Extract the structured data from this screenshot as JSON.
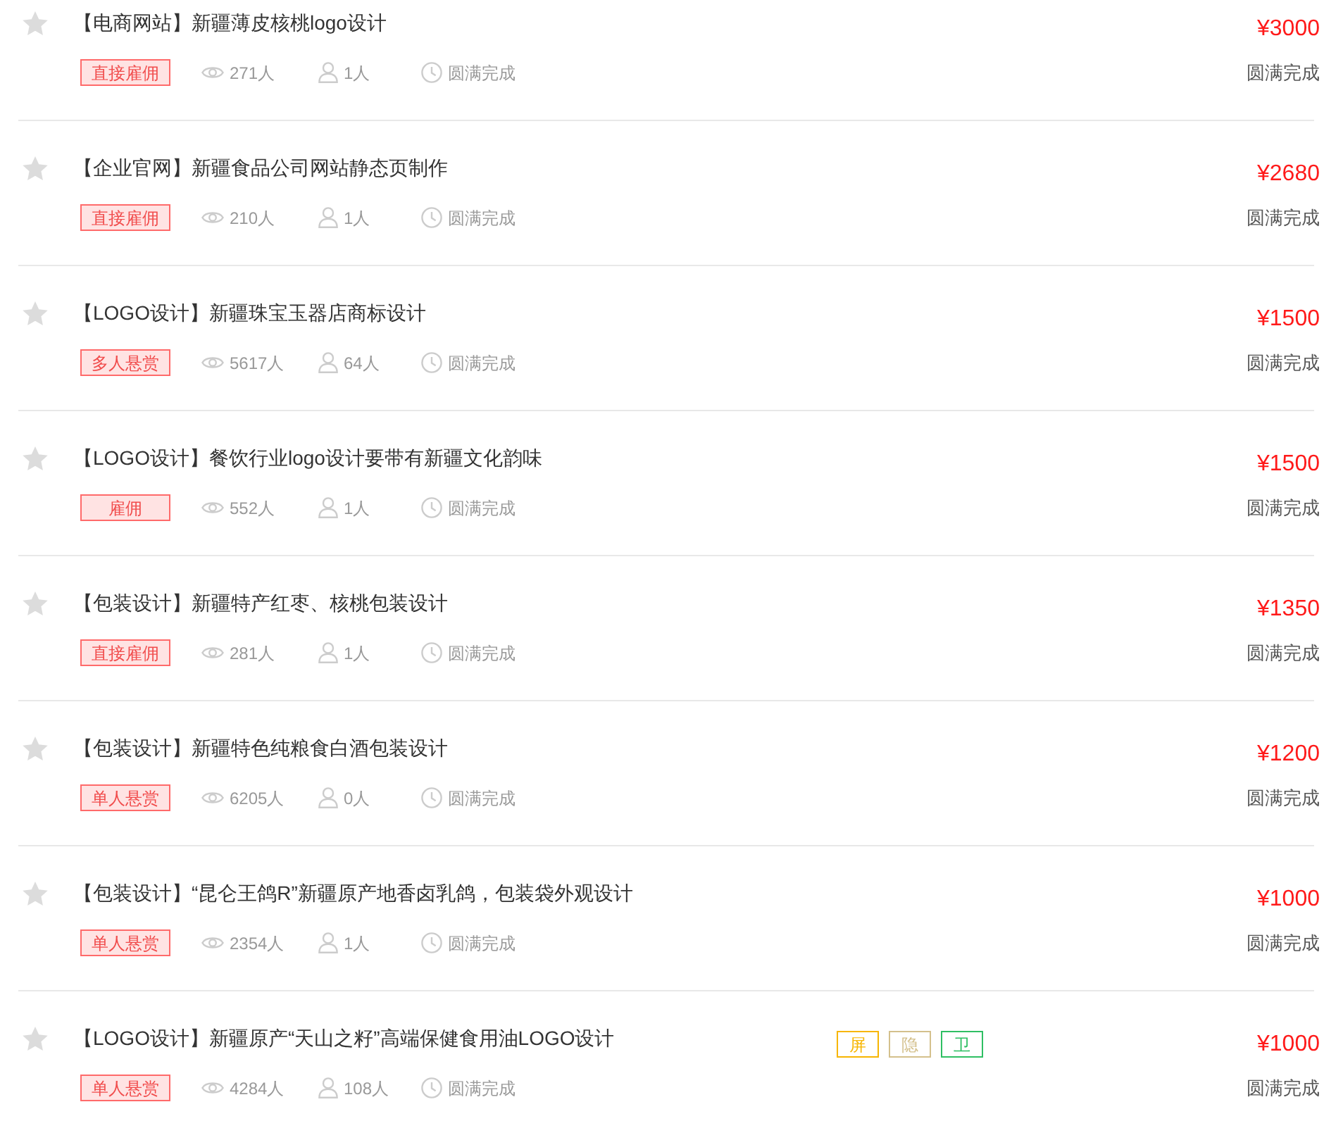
{
  "tasks": [
    {
      "favorited": false,
      "title": "【电商网站】新疆薄皮核桃logo设计",
      "tag": "直接雇佣",
      "views": "271人",
      "participants": "1人",
      "progress": "圆满完成",
      "price": "¥3000",
      "status": "圆满完成"
    },
    {
      "favorited": false,
      "title": "【企业官网】新疆食品公司网站静态页制作",
      "tag": "直接雇佣",
      "views": "210人",
      "participants": "1人",
      "progress": "圆满完成",
      "price": "¥2680",
      "status": "圆满完成"
    },
    {
      "favorited": false,
      "title": "【LOGO设计】新疆珠宝玉器店商标设计",
      "tag": "多人悬赏",
      "views": "5617人",
      "participants": "64人",
      "progress": "圆满完成",
      "price": "¥1500",
      "status": "圆满完成"
    },
    {
      "favorited": false,
      "title": "【LOGO设计】餐饮行业logo设计要带有新疆文化韵味",
      "tag": "雇佣",
      "views": "552人",
      "participants": "1人",
      "progress": "圆满完成",
      "price": "¥1500",
      "status": "圆满完成"
    },
    {
      "favorited": false,
      "title": "【包装设计】新疆特产红枣、核桃包装设计",
      "tag": "直接雇佣",
      "views": "281人",
      "participants": "1人",
      "progress": "圆满完成",
      "price": "¥1350",
      "status": "圆满完成"
    },
    {
      "favorited": false,
      "title": "【包装设计】新疆特色纯粮食白酒包装设计",
      "tag": "单人悬赏",
      "views": "6205人",
      "participants": "0人",
      "progress": "圆满完成",
      "price": "¥1200",
      "status": "圆满完成"
    },
    {
      "favorited": false,
      "title": "【包装设计】“昆仑王鸽R”新疆原产地香卤乳鸽，包装袋外观设计",
      "tag": "单人悬赏",
      "views": "2354人",
      "participants": "1人",
      "progress": "圆满完成",
      "price": "¥1000",
      "status": "圆满完成"
    },
    {
      "favorited": false,
      "title": "【LOGO设计】新疆原产“天山之籽”高端保健食用油LOGO设计",
      "tag": "单人悬赏",
      "views": "4284人",
      "participants": "108人",
      "progress": "圆满完成",
      "price": "¥1000",
      "status": "圆满完成",
      "badges": [
        {
          "label": "屏",
          "color": "#f7b500"
        },
        {
          "label": "隐",
          "color": "#d4c08c"
        },
        {
          "label": "卫",
          "color": "#2fbf63"
        }
      ]
    }
  ]
}
